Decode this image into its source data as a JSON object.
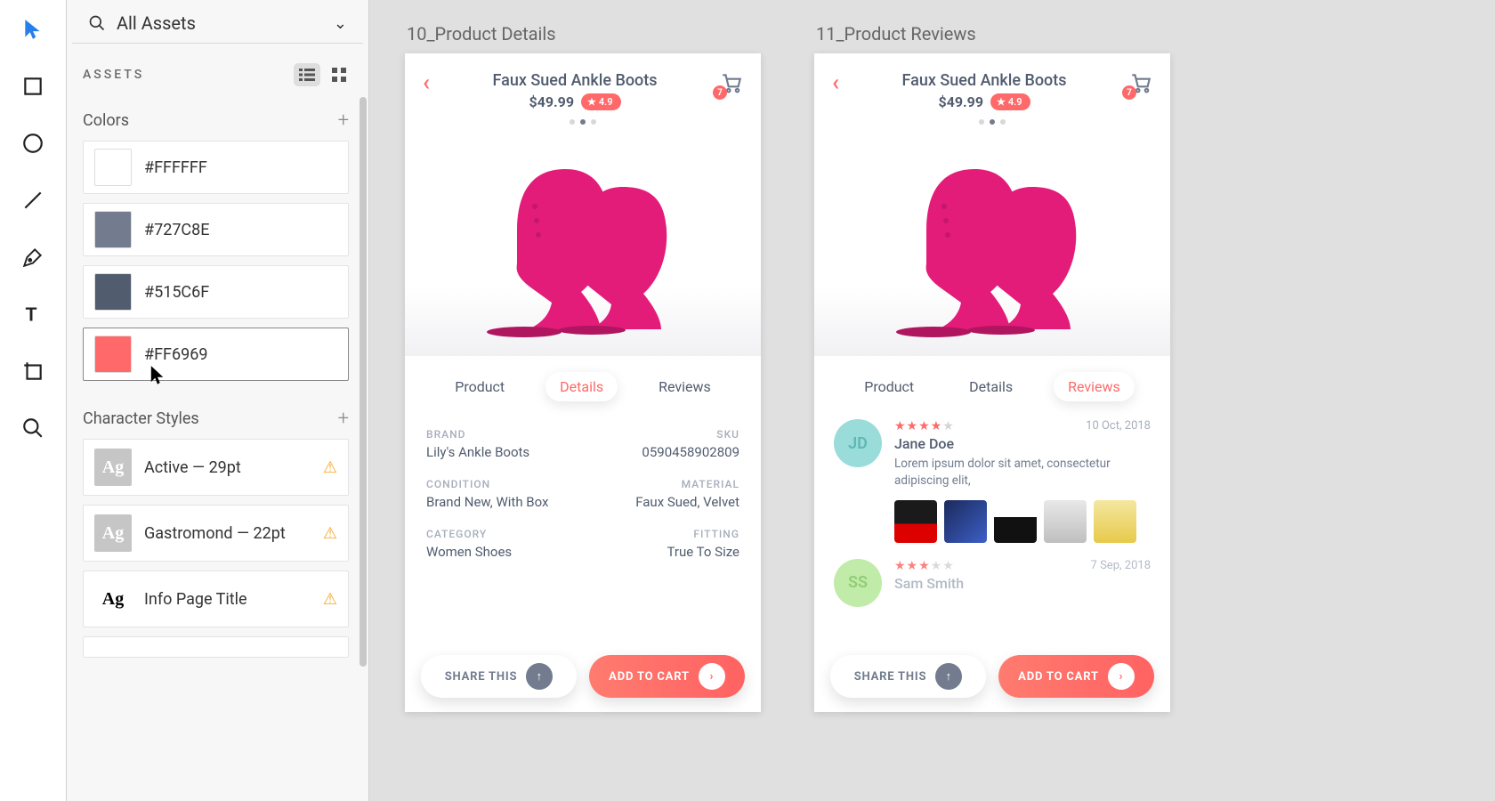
{
  "search": {
    "label": "All Assets"
  },
  "sections": {
    "assets": "ASSETS",
    "colors": "Colors",
    "charstyles": "Character Styles"
  },
  "colors": [
    {
      "hex": "#FFFFFF",
      "label": "#FFFFFF"
    },
    {
      "hex": "#727C8E",
      "label": "#727C8E"
    },
    {
      "hex": "#515C6F",
      "label": "#515C6F"
    },
    {
      "hex": "#FF6969",
      "label": "#FF6969"
    }
  ],
  "charstyles": [
    {
      "label": "Active — 29pt",
      "badge": "light"
    },
    {
      "label": "Gastromond — 22pt",
      "badge": "light"
    },
    {
      "label": "Info Page Title",
      "badge": "dark"
    }
  ],
  "artboards": {
    "details": {
      "label": "10_Product Details",
      "title": "Faux Sued Ankle Boots",
      "price": "$49.99",
      "rating": "4.9",
      "cart_count": "7",
      "tabs": [
        "Product",
        "Details",
        "Reviews"
      ],
      "active_tab": 1,
      "rows": [
        {
          "l_label": "BRAND",
          "l_val": "Lily's Ankle Boots",
          "r_label": "SKU",
          "r_val": "0590458902809"
        },
        {
          "l_label": "CONDITION",
          "l_val": "Brand New, With Box",
          "r_label": "MATERIAL",
          "r_val": "Faux Sued, Velvet"
        },
        {
          "l_label": "CATEGORY",
          "l_val": "Women Shoes",
          "r_label": "FITTING",
          "r_val": "True To Size"
        }
      ],
      "share": "SHARE THIS",
      "add": "ADD TO CART"
    },
    "reviews": {
      "label": "11_Product Reviews",
      "title": "Faux Sued Ankle Boots",
      "price": "$49.99",
      "rating": "4.9",
      "cart_count": "7",
      "tabs": [
        "Product",
        "Details",
        "Reviews"
      ],
      "active_tab": 2,
      "reviews": [
        {
          "initials": "JD",
          "avatar_color": "#9ADCDA",
          "name": "Jane Doe",
          "date": "10 Oct, 2018",
          "stars": 4,
          "text": "Lorem ipsum dolor sit amet, consectetur adipiscing elit,"
        },
        {
          "initials": "SS",
          "avatar_color": "#B6E89A",
          "name": "Sam Smith",
          "date": "7 Sep, 2018",
          "stars": 3,
          "text": ""
        }
      ],
      "share": "SHARE THIS",
      "add": "ADD TO CART"
    }
  }
}
